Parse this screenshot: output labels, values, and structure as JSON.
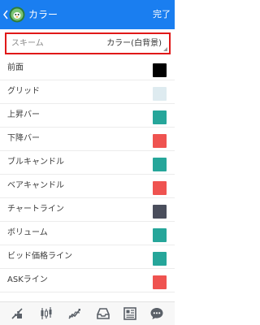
{
  "header": {
    "title": "カラー",
    "done_label": "完了"
  },
  "scheme": {
    "label": "スキーム",
    "value": "カラー(白背景)"
  },
  "colors": [
    {
      "label": "前面",
      "color": "#000000"
    },
    {
      "label": "グリッド",
      "color": "#deebf0"
    },
    {
      "label": "上昇バー",
      "color": "#26a69a"
    },
    {
      "label": "下降バー",
      "color": "#ef5350"
    },
    {
      "label": "ブルキャンドル",
      "color": "#26a69a"
    },
    {
      "label": "ベアキャンドル",
      "color": "#ef5350"
    },
    {
      "label": "チャートライン",
      "color": "#4a4e5c"
    },
    {
      "label": "ボリューム",
      "color": "#26a69a"
    },
    {
      "label": "ビッド価格ライン",
      "color": "#26a69a"
    },
    {
      "label": "ASKライン",
      "color": "#ef5350"
    }
  ],
  "toolbar": {
    "icons": [
      "trade-icon",
      "chart-candles-icon",
      "indicators-icon",
      "inbox-icon",
      "news-icon",
      "chat-icon"
    ]
  },
  "theme": {
    "header_bg": "#1a7ef0",
    "highlight_border": "#e01818",
    "icon_color": "#5a6068"
  }
}
